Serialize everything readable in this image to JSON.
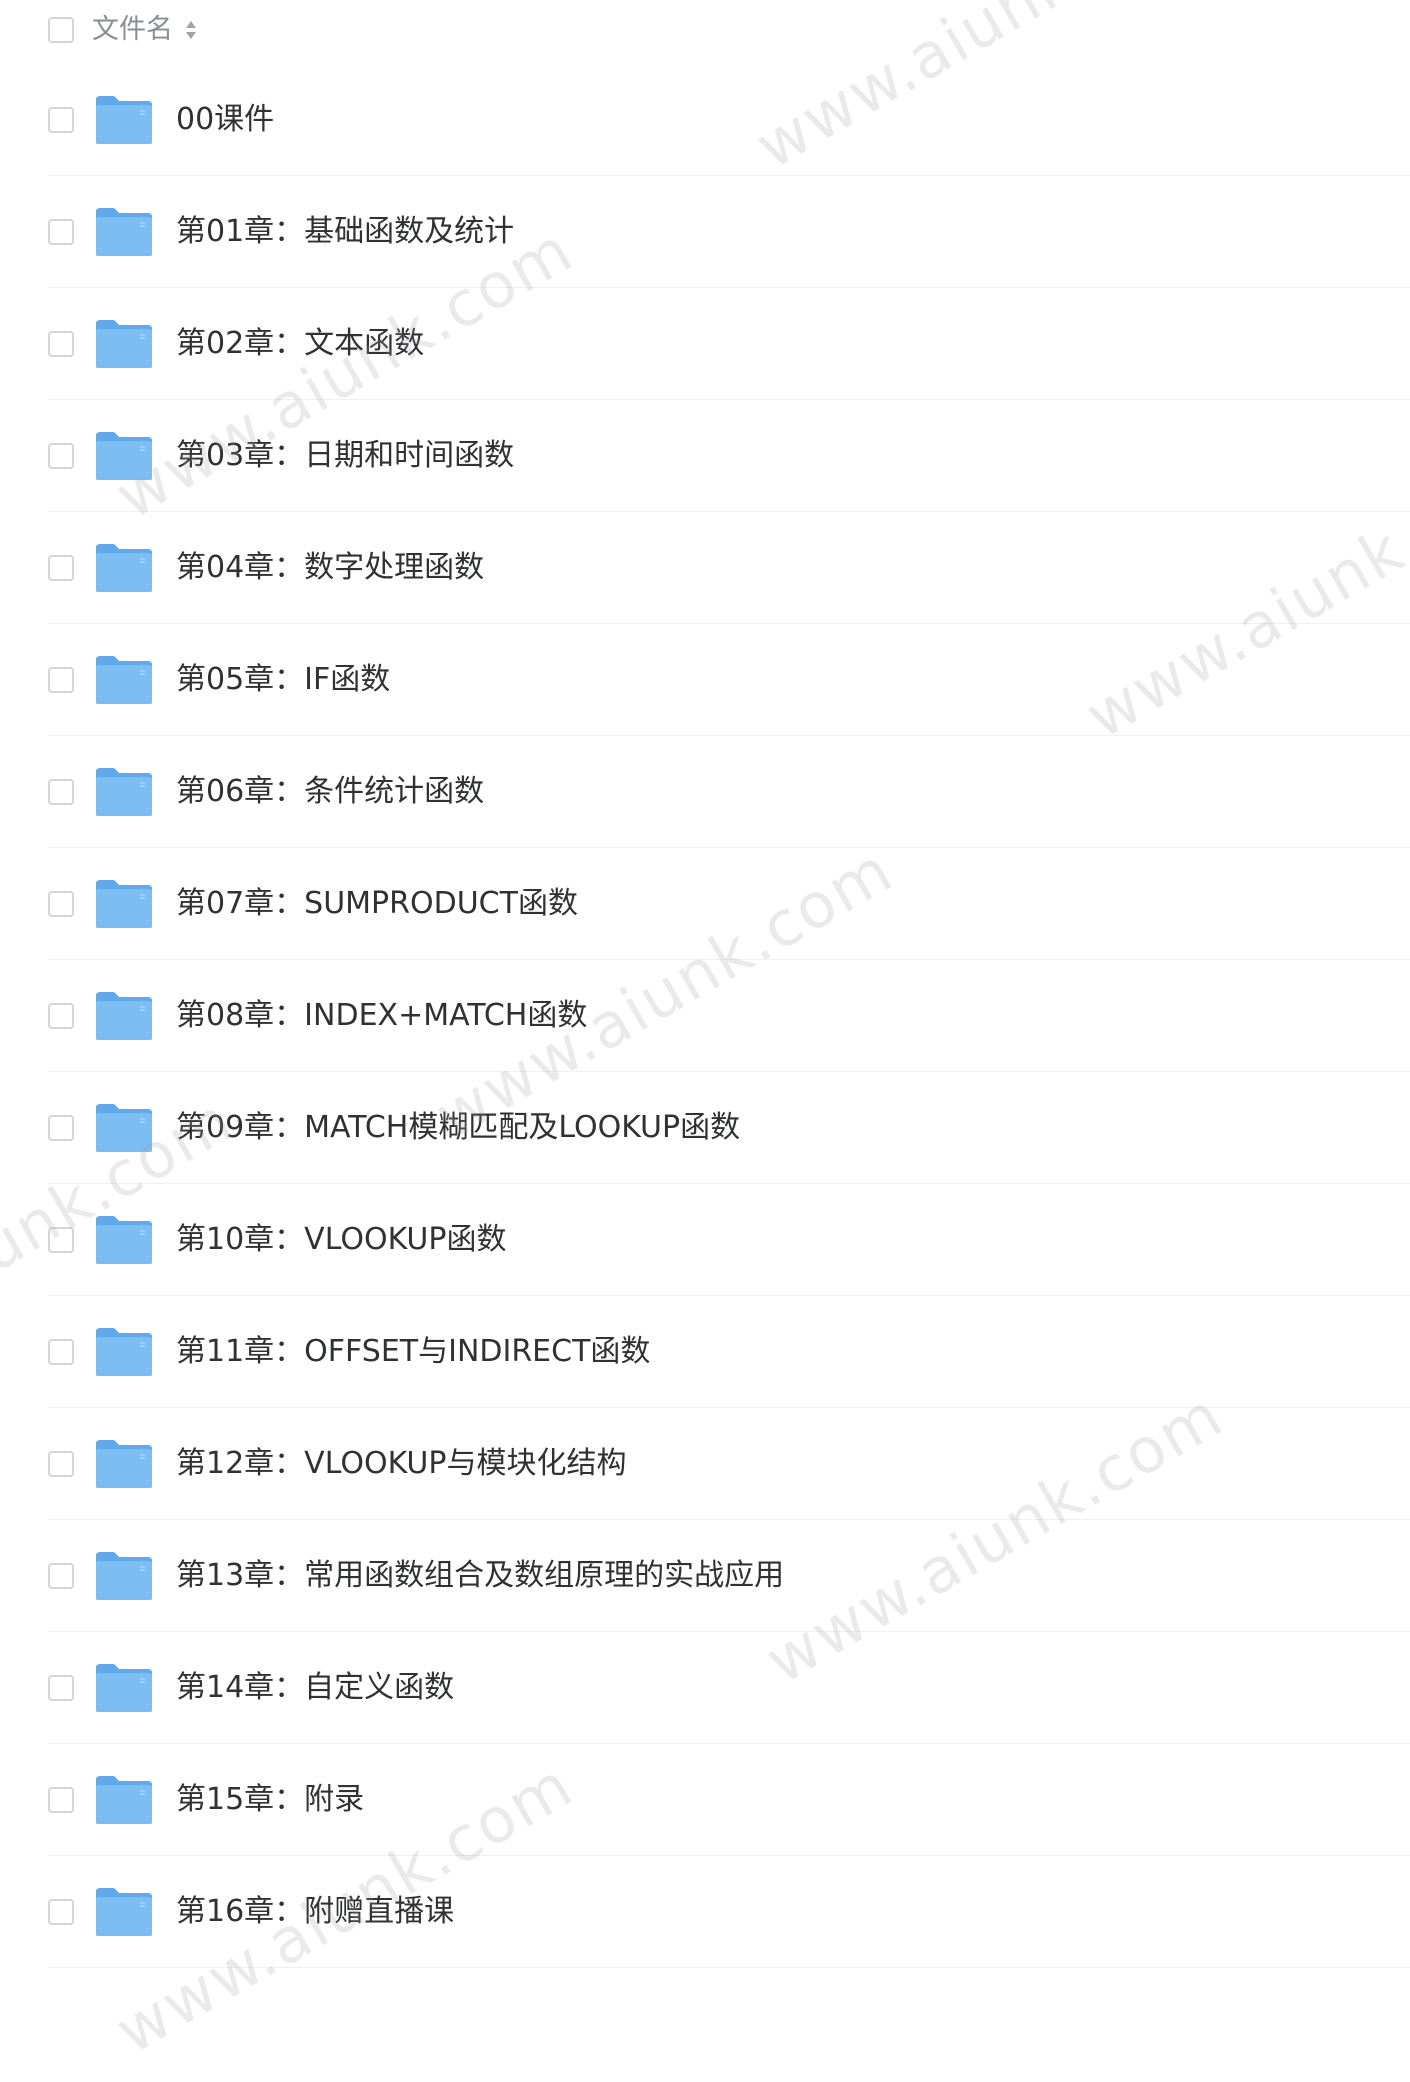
{
  "header": {
    "column_label": "文件名",
    "sort_icon": "sort-icon"
  },
  "folders": [
    {
      "name": "00课件"
    },
    {
      "name": "第01章：基础函数及统计"
    },
    {
      "name": "第02章：文本函数"
    },
    {
      "name": "第03章：日期和时间函数"
    },
    {
      "name": "第04章：数字处理函数"
    },
    {
      "name": "第05章：IF函数"
    },
    {
      "name": "第06章：条件统计函数"
    },
    {
      "name": "第07章：SUMPRODUCT函数"
    },
    {
      "name": "第08章：INDEX+MATCH函数"
    },
    {
      "name": "第09章：MATCH模糊匹配及LOOKUP函数"
    },
    {
      "name": "第10章：VLOOKUP函数"
    },
    {
      "name": "第11章：OFFSET与INDIRECT函数"
    },
    {
      "name": "第12章：VLOOKUP与模块化结构"
    },
    {
      "name": "第13章：常用函数组合及数组原理的实战应用"
    },
    {
      "name": "第14章：自定义函数"
    },
    {
      "name": "第15章：附录"
    },
    {
      "name": "第16章：附赠直播课"
    }
  ],
  "icons": {
    "folder": "folder-icon",
    "checkbox": "checkbox"
  },
  "colors": {
    "folder": "#7cbdf2",
    "folder_back": "#5fa9ec",
    "text": "#303133",
    "header_text": "#8a8d93",
    "divider": "#eef0f3"
  },
  "watermark_text": "www.aiunk.com"
}
